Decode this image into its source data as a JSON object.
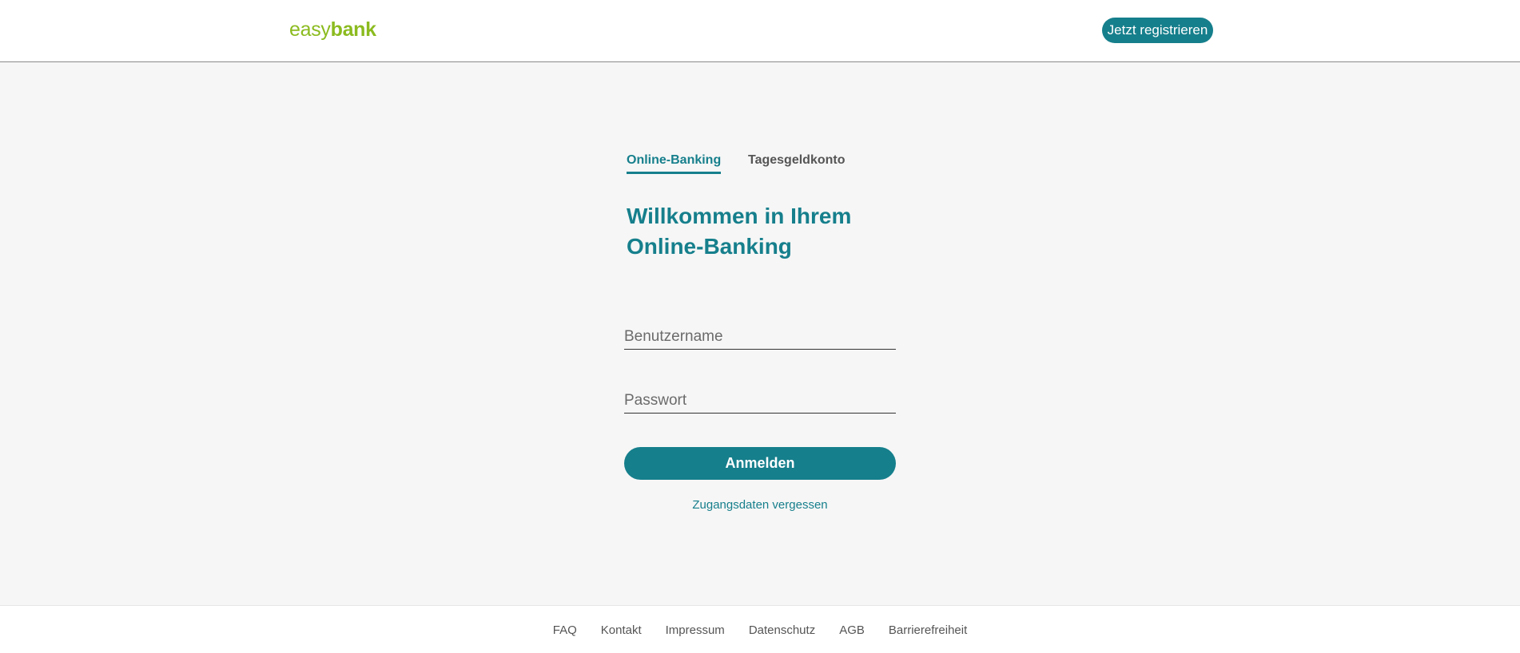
{
  "header": {
    "logo": {
      "part1": "easy",
      "part2": "bank"
    },
    "register_label": "Jetzt registrieren"
  },
  "tabs": [
    {
      "label": "Online-Banking",
      "active": true
    },
    {
      "label": "Tagesgeldkonto",
      "active": false
    }
  ],
  "welcome": {
    "line1": "Willkommen in Ihrem",
    "line2": "Online-Banking"
  },
  "form": {
    "username_placeholder": "Benutzername",
    "password_placeholder": "Passwort",
    "login_label": "Anmelden",
    "forgot_label": "Zugangsdaten vergessen"
  },
  "footer": {
    "links": [
      "FAQ",
      "Kontakt",
      "Impressum",
      "Datenschutz",
      "AGB",
      "Barrierefreiheit"
    ]
  },
  "colors": {
    "brand_green": "#8bbb1f",
    "accent_teal": "#167f8c",
    "background": "#f6f6f6"
  }
}
